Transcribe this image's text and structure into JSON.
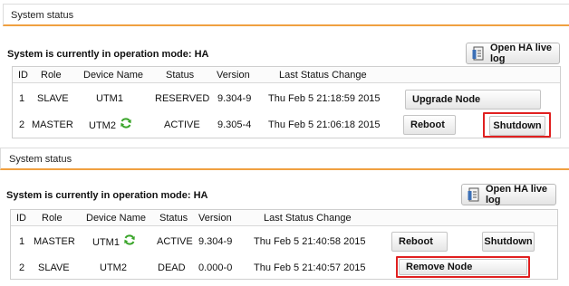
{
  "panels": [
    {
      "title": "System status",
      "mode_text": "System is currently in operation mode: HA",
      "live_log_label": "Open HA live log",
      "columns": [
        "ID",
        "Role",
        "Device Name",
        "Status",
        "Version",
        "Last Status Change"
      ],
      "rows": [
        {
          "id": "1",
          "role": "SLAVE",
          "device": "UTM1",
          "status": "RESERVED",
          "version": "9.304-9",
          "last_change": "Thu Feb 5 21:18:59 2015",
          "actions": [
            "Upgrade Node"
          ]
        },
        {
          "id": "2",
          "role": "MASTER",
          "device": "UTM2",
          "status": "ACTIVE",
          "version": "9.305-4",
          "last_change": "Thu Feb 5 21:06:18 2015",
          "actions": [
            "Reboot",
            "Shutdown"
          ]
        }
      ]
    },
    {
      "title": "System status",
      "mode_text": "System is currently in operation mode: HA",
      "live_log_label": "Open HA live log",
      "columns": [
        "ID",
        "Role",
        "Device Name",
        "Status",
        "Version",
        "Last Status Change"
      ],
      "rows": [
        {
          "id": "1",
          "role": "MASTER",
          "device": "UTM1",
          "status": "ACTIVE",
          "version": "9.304-9",
          "last_change": "Thu Feb 5 21:40:58 2015",
          "actions": [
            "Reboot",
            "Shutdown"
          ]
        },
        {
          "id": "2",
          "role": "SLAVE",
          "device": "UTM2",
          "status": "DEAD",
          "version": "0.000-0",
          "last_change": "Thu Feb 5 21:40:57 2015",
          "actions": [
            "Remove Node"
          ]
        }
      ]
    }
  ],
  "colors": {
    "header_underline": "#f0a040",
    "highlight": "#e02020",
    "refresh_icon": "#3aa52a"
  },
  "icons": {
    "refresh": "refresh-icon",
    "log": "log-icon"
  }
}
